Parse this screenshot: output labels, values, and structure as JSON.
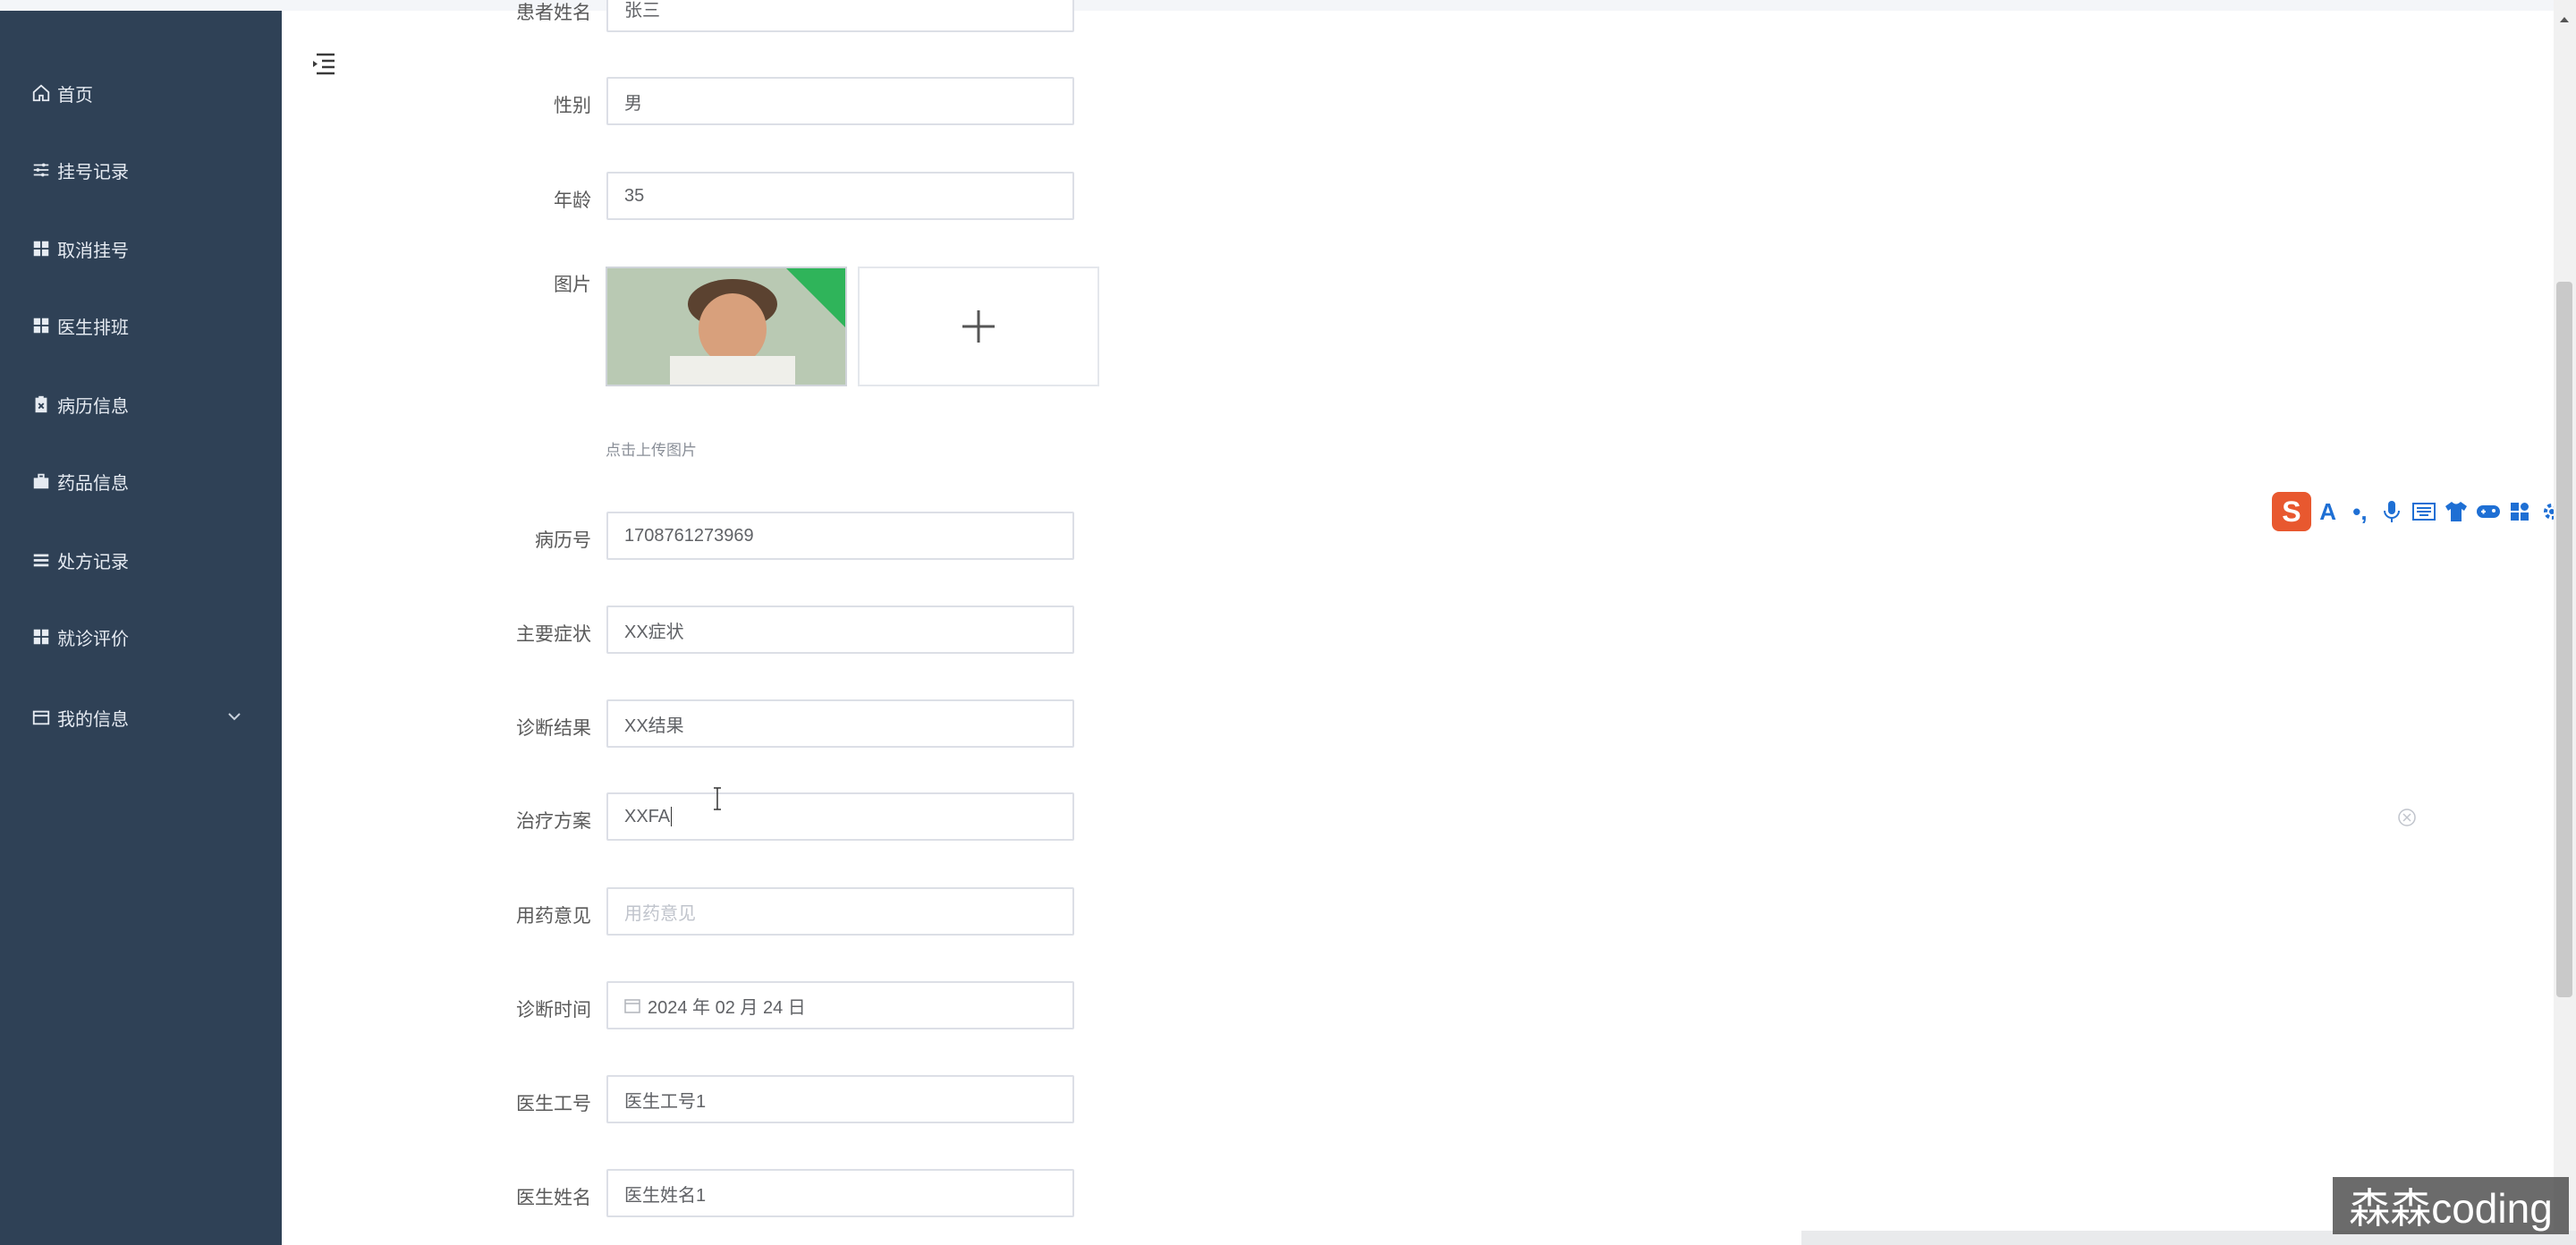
{
  "sidebar": {
    "items": [
      {
        "label": "首页",
        "icon": "home-icon"
      },
      {
        "label": "挂号记录",
        "icon": "sliders-icon"
      },
      {
        "label": "取消挂号",
        "icon": "grid-icon"
      },
      {
        "label": "医生排班",
        "icon": "grid-icon"
      },
      {
        "label": "病历信息",
        "icon": "clipboard-icon"
      },
      {
        "label": "药品信息",
        "icon": "briefcase-icon"
      },
      {
        "label": "处方记录",
        "icon": "list-icon"
      },
      {
        "label": "就诊评价",
        "icon": "grid-icon"
      },
      {
        "label": "我的信息",
        "icon": "wallet-icon"
      }
    ]
  },
  "form": {
    "patient_name": {
      "label": "患者姓名",
      "value": "张三"
    },
    "gender": {
      "label": "性别",
      "value": "男"
    },
    "age": {
      "label": "年龄",
      "value": "35"
    },
    "image": {
      "label": "图片",
      "upload_hint": "点击上传图片"
    },
    "record_no": {
      "label": "病历号",
      "value": "1708761273969"
    },
    "symptoms": {
      "label": "主要症状",
      "value": "XX症状"
    },
    "diagnosis": {
      "label": "诊断结果",
      "value": "XX结果"
    },
    "treatment": {
      "label": "治疗方案",
      "value": "XXFA"
    },
    "medication": {
      "label": "用药意见",
      "placeholder": "用药意见"
    },
    "diag_time": {
      "label": "诊断时间",
      "value": "2024 年 02 月 24 日"
    },
    "doctor_no": {
      "label": "医生工号",
      "value": "医生工号1"
    },
    "doctor_name": {
      "label": "医生姓名",
      "value": "医生姓名1"
    }
  },
  "ime": {
    "logo": "S",
    "items": [
      "A",
      "•,",
      "🎤",
      "⌨",
      "👕",
      "🎮",
      "▦",
      "⚙"
    ]
  },
  "watermark": "森森coding",
  "colors": {
    "sidebar": "#2f4156",
    "ime_accent": "#1e6fd4",
    "ime_logo": "#e8582f"
  }
}
